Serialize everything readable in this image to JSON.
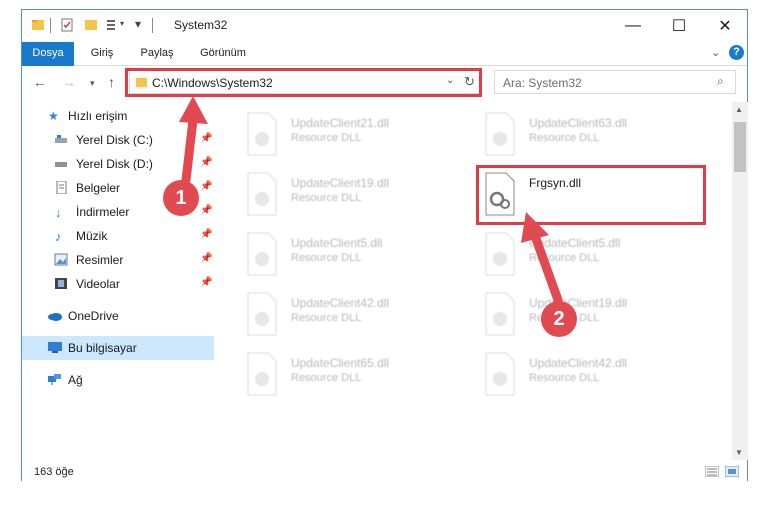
{
  "window": {
    "title": "System32",
    "controls": {
      "minimize": "—",
      "maximize": "☐",
      "close": "✕"
    }
  },
  "ribbon": {
    "tabs": [
      {
        "label": "Dosya"
      },
      {
        "label": "Giriş"
      },
      {
        "label": "Paylaş"
      },
      {
        "label": "Görünüm"
      }
    ],
    "expand_icon": "chevron-down-icon",
    "help_icon": "help-icon"
  },
  "address": {
    "path": "C:\\Windows\\System32",
    "search_placeholder": "Ara: System32"
  },
  "nav": {
    "items": [
      {
        "label": "Hızlı erişim",
        "icon": "star-icon",
        "pinned": false
      },
      {
        "label": "Yerel Disk (C:)",
        "icon": "drive-icon",
        "pinned": true
      },
      {
        "label": "Yerel Disk (D:)",
        "icon": "drive-icon",
        "pinned": true
      },
      {
        "label": "Belgeler",
        "icon": "documents-icon",
        "pinned": true
      },
      {
        "label": "İndirmeler",
        "icon": "download-icon",
        "pinned": true
      },
      {
        "label": "Müzik",
        "icon": "music-icon",
        "pinned": true
      },
      {
        "label": "Resimler",
        "icon": "pictures-icon",
        "pinned": true
      },
      {
        "label": "Videolar",
        "icon": "videos-icon",
        "pinned": true
      },
      {
        "label": "OneDrive",
        "icon": "cloud-icon",
        "pinned": false
      },
      {
        "label": "Bu bilgisayar",
        "icon": "computer-icon",
        "pinned": false,
        "selected": true
      },
      {
        "label": "Ağ",
        "icon": "network-icon",
        "pinned": false
      }
    ]
  },
  "files": [
    {
      "name": "UpdateClient21.dll",
      "desc": "Resource DLL",
      "highlight": false
    },
    {
      "name": "UpdateClient63.dll",
      "desc": "Resource DLL",
      "highlight": false
    },
    {
      "name": "UpdateClient19.dll",
      "desc": "Resource DLL",
      "highlight": false
    },
    {
      "name": "Frgsyn.dll",
      "desc": "",
      "highlight": true
    },
    {
      "name": "UpdateClient5.dll",
      "desc": "Resource DLL",
      "highlight": false
    },
    {
      "name": "UpdateClient5.dll",
      "desc": "Resource DLL",
      "highlight": false
    },
    {
      "name": "UpdateClient42.dll",
      "desc": "Resource DLL",
      "highlight": false
    },
    {
      "name": "UpdateClient19.dll",
      "desc": "Resource DLL",
      "highlight": false
    },
    {
      "name": "UpdateClient65.dll",
      "desc": "Resource DLL",
      "highlight": false
    },
    {
      "name": "UpdateClient42.dll",
      "desc": "Resource DLL",
      "highlight": false
    }
  ],
  "status": {
    "count": "163 öğe"
  },
  "annotations": {
    "step1": "1",
    "step2": "2",
    "color": "#e03c45"
  }
}
